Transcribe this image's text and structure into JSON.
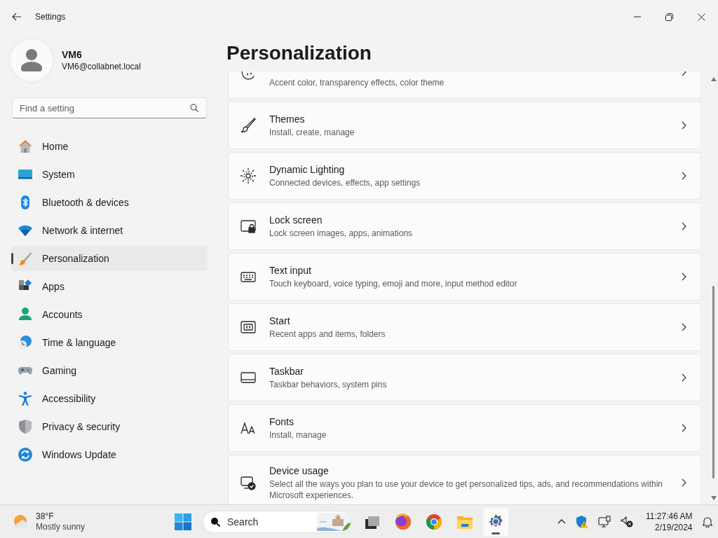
{
  "window": {
    "title": "Settings"
  },
  "profile": {
    "name": "VM6",
    "email": "VM6@collabnet.local"
  },
  "search": {
    "placeholder": "Find a setting"
  },
  "nav": [
    {
      "label": "Home",
      "selected": false
    },
    {
      "label": "System",
      "selected": false
    },
    {
      "label": "Bluetooth & devices",
      "selected": false
    },
    {
      "label": "Network & internet",
      "selected": false
    },
    {
      "label": "Personalization",
      "selected": true
    },
    {
      "label": "Apps",
      "selected": false
    },
    {
      "label": "Accounts",
      "selected": false
    },
    {
      "label": "Time & language",
      "selected": false
    },
    {
      "label": "Gaming",
      "selected": false
    },
    {
      "label": "Accessibility",
      "selected": false
    },
    {
      "label": "Privacy & security",
      "selected": false
    },
    {
      "label": "Windows Update",
      "selected": false
    }
  ],
  "page_title": "Personalization",
  "settings": [
    {
      "kind": "cut",
      "subtitle": "Accent color, transparency effects, color theme"
    },
    {
      "kind": "card",
      "title": "Themes",
      "subtitle": "Install, create, manage"
    },
    {
      "kind": "card",
      "title": "Dynamic Lighting",
      "subtitle": "Connected devices, effects, app settings"
    },
    {
      "kind": "card",
      "title": "Lock screen",
      "subtitle": "Lock screen images, apps, animations"
    },
    {
      "kind": "card",
      "title": "Text input",
      "subtitle": "Touch keyboard, voice typing, emoji and more, input method editor"
    },
    {
      "kind": "card",
      "title": "Start",
      "subtitle": "Recent apps and items, folders"
    },
    {
      "kind": "card",
      "title": "Taskbar",
      "subtitle": "Taskbar behaviors, system pins"
    },
    {
      "kind": "card",
      "title": "Fonts",
      "subtitle": "Install, manage"
    },
    {
      "kind": "card",
      "title": "Device usage",
      "subtitle": "Select all the ways you plan to use your device to get personalized tips, ads, and recommendations within Microsoft experiences."
    }
  ],
  "taskbar": {
    "weather": {
      "temperature": "38°F",
      "condition": "Mostly sunny"
    },
    "search_placeholder": "Search",
    "apps": [
      {
        "running": false
      },
      {
        "running": false
      },
      {
        "running": false
      },
      {
        "running": false
      },
      {
        "running": true
      }
    ],
    "clock": {
      "time": "11:27:46 AM",
      "date": "2/19/2024"
    }
  }
}
